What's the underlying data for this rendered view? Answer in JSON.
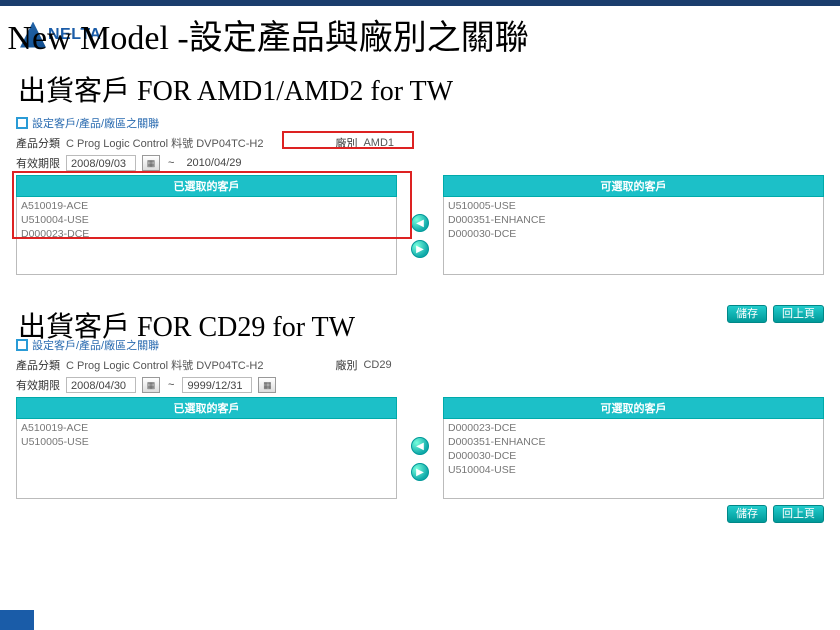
{
  "logo_text": "NELTA",
  "slide_title": "New Model -設定產品與廠別之關聯",
  "section1": {
    "title": "出貨客戶 FOR AMD1/AMD2 for TW",
    "panel_head": "設定客戶/產品/廠區之關聯",
    "product_label": "產品分類",
    "product_value": "C   Prog Logic Control 料號 DVP04TC-H2",
    "plant_label": "廠別",
    "plant_value": "AMD1",
    "date_label": "有效期限",
    "date_from": "2008/09/03",
    "date_to": "2010/04/29",
    "selected_header": "已選取的客戶",
    "available_header": "可選取的客戶",
    "selected": [
      "A510019-ACE",
      "U510004-USE",
      "D000023-DCE"
    ],
    "available": [
      "U510005-USE",
      "D000351-ENHANCE",
      "D000030-DCE"
    ]
  },
  "actions": {
    "save": "儲存",
    "back": "回上頁"
  },
  "section2": {
    "title": "出貨客戶 FOR CD29 for TW",
    "panel_head": "設定客戶/產品/廠區之關聯",
    "product_label": "產品分類",
    "product_value": "C   Prog Logic Control 料號 DVP04TC-H2",
    "plant_label": "廠別",
    "plant_value": "CD29",
    "date_label": "有效期限",
    "date_from": "2008/04/30",
    "date_to": "9999/12/31",
    "selected_header": "已選取的客戶",
    "available_header": "可選取的客戶",
    "selected": [
      "A510019-ACE",
      "U510005-USE"
    ],
    "available": [
      "D000023-DCE",
      "D000351-ENHANCE",
      "D000030-DCE",
      "U510004-USE"
    ]
  },
  "actions2": {
    "save": "儲存",
    "back": "回上頁"
  }
}
